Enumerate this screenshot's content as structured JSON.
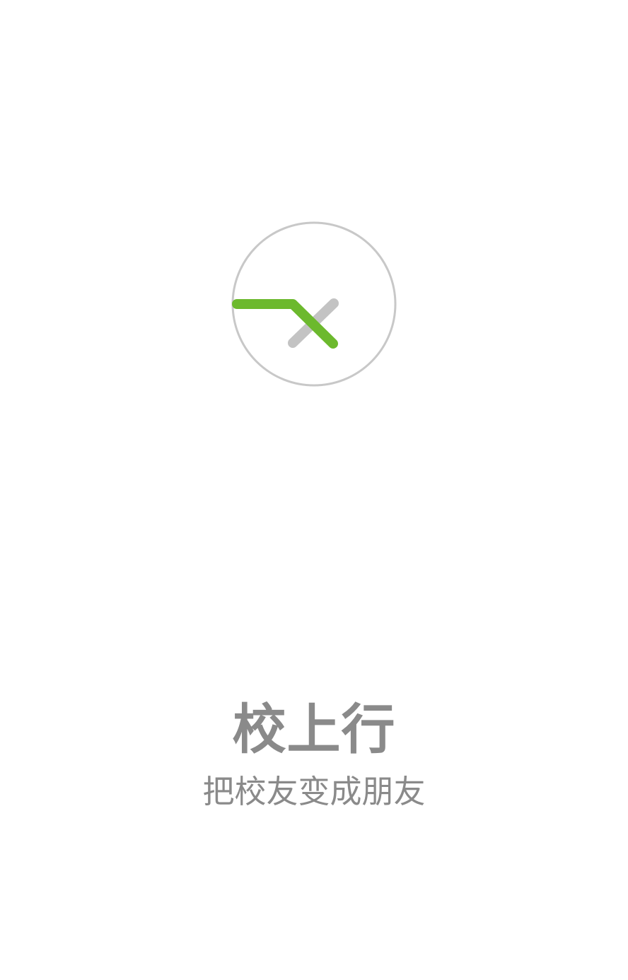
{
  "splash": {
    "logo_icon": "circle-check-cross-logo-icon",
    "app_name": "校上行",
    "slogan": "把校友变成朋友",
    "colors": {
      "background": "#ffffff",
      "text": "#8a8a8a",
      "circle": "#c8c8c8",
      "gray_stroke": "#c3c3c3",
      "green_stroke": "#6cb92d"
    }
  }
}
